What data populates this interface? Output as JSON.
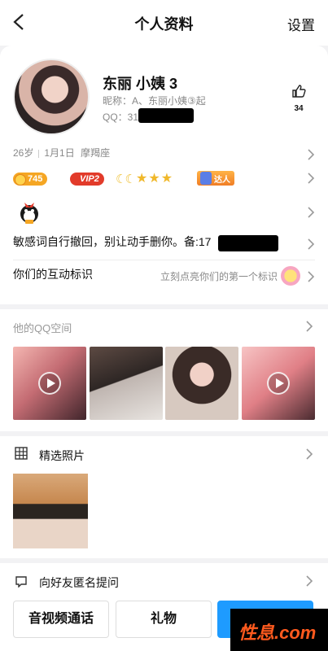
{
  "header": {
    "title": "个人资料",
    "settings_label": "设置"
  },
  "profile": {
    "name": "东丽 小姨 3",
    "nickname": "昵称：A、东丽小姨③起",
    "qq": "QQ：31",
    "likes": "34",
    "age": "26岁",
    "birthday": "1月1日",
    "zodiac": "摩羯座"
  },
  "badges": {
    "level": "745",
    "vip": "VIP2",
    "talent": "达人",
    "stars": "★★★",
    "moons": "☾☾"
  },
  "signature": "敏感词自行撤回，别让动手删你。备:17",
  "interact": {
    "label": "你们的互动标识",
    "hint": "立刻点亮你们的第一个标识"
  },
  "space": {
    "header": "他的QQ空间"
  },
  "featured": {
    "label": "精选照片"
  },
  "ask": {
    "label": "向好友匿名提问"
  },
  "actions": {
    "call": "音视频通话",
    "gift": "礼物"
  },
  "watermark": "性息.com"
}
